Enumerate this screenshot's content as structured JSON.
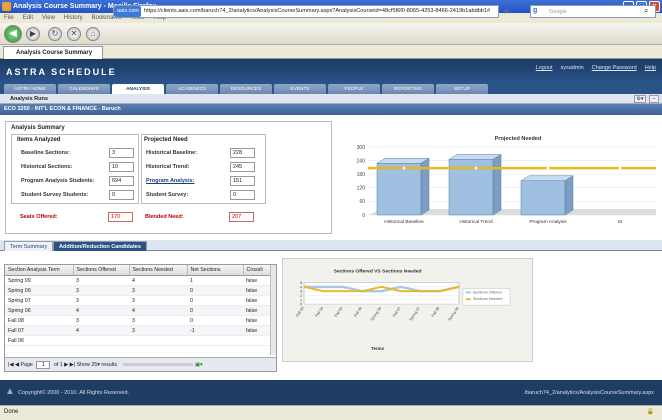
{
  "browser": {
    "title": "Analysis Course Summary - Mozilla Firefox",
    "menu": [
      "File",
      "Edit",
      "View",
      "History",
      "Bookmarks",
      "Tools",
      "Help"
    ],
    "url_badge": "aais.com",
    "url": "https://clients.aais.com/baruch74_2/analytics/AnalysisCourseSummary.aspx?AnalysisCourseid=48cf5f6f0-8065-4253-8466-2419b1abdbb1#",
    "search_placeholder": "Google",
    "tab": "Analysis Course Summary",
    "status": "Done"
  },
  "app": {
    "logo": "ASTRA SCHEDULE",
    "links": [
      "Logout",
      "sysadmin",
      "Change Password",
      "Help"
    ],
    "tabs": [
      "ASTRA HOME",
      "CALENDARS",
      "ANALYSIS",
      "ACADEMICS",
      "RESOURCES",
      "EVENTS",
      "PEOPLE",
      "REPORTING",
      "SETUP"
    ],
    "active_tab": "ANALYSIS",
    "subnav": "Analysis Runs",
    "section": "ECO 3250 - INT'L ECON & FINANCE - Baruch"
  },
  "summary": {
    "title": "Analysis Summary",
    "items_title": "Items Analyzed",
    "projected_title": "Projected Need",
    "items": [
      {
        "label": "Baseline Sections:",
        "value": "3"
      },
      {
        "label": "Historical Sections:",
        "value": "10"
      },
      {
        "label": "Program Analysis Students:",
        "value": "694"
      },
      {
        "label": "Student Survey Students:",
        "value": "0"
      }
    ],
    "projected": [
      {
        "label": "Historical Baseline:",
        "value": "228"
      },
      {
        "label": "Historical Trend:",
        "value": "245"
      },
      {
        "label": "Program Analysis:",
        "value": "151"
      },
      {
        "label": "Student Survey:",
        "value": "0"
      }
    ],
    "seats_label": "Seats Offered:",
    "seats_value": "170",
    "blended_label": "Blended Need:",
    "blended_value": "207"
  },
  "tabs2": [
    "Term Summary",
    "Addition/Reduction Candidates"
  ],
  "grid": {
    "headers": [
      "Section Analysis Term",
      "Sections Offered",
      "Sections Needed",
      "Net Sections",
      "Crossli"
    ],
    "rows": [
      [
        "Spring 09",
        "3",
        "4",
        "1",
        "false"
      ],
      [
        "Spring 09",
        "3",
        "3",
        "0",
        "false"
      ],
      [
        "Spring 07",
        "3",
        "3",
        "0",
        "false"
      ],
      [
        "Spring 06",
        "4",
        "4",
        "0",
        "false"
      ],
      [
        "Fall 08",
        "3",
        "3",
        "0",
        "false"
      ],
      [
        "Fall 07",
        "4",
        "3",
        "-1",
        "false"
      ],
      [
        "Fall 06",
        "",
        "",
        "",
        ""
      ]
    ],
    "pager": {
      "page_label": "Page",
      "page": "1",
      "of": "of 1",
      "show_label": "Show",
      "show_value": "25",
      "results": "results"
    }
  },
  "footer": {
    "copyright": "Copyright© 2000 - 2010. All Rights Reserved.",
    "path": "/baruch74_2/analytics/AnalysisCourseSummary.aspx"
  },
  "chart_data": [
    {
      "type": "bar",
      "title": "Projected Needed",
      "categories": [
        "Historical Baseline",
        "Historical Trend",
        "Program Analysis",
        "St"
      ],
      "values": [
        228,
        245,
        151,
        0
      ],
      "ylim": [
        0,
        300
      ],
      "yticks": [
        0,
        60,
        120,
        180,
        240,
        300
      ],
      "reference_line": 207,
      "colors": {
        "bar": "#9fc0e0",
        "line": "#e8b820"
      }
    },
    {
      "type": "line",
      "title": "Sections Offered VS Sections Needed",
      "xlabel": "Terms",
      "categories": [
        "Fall 03",
        "Fall 04",
        "Fall 05",
        "Fall 06",
        "Spring 06",
        "Fall 07",
        "Spring 07",
        "Fall 08",
        "Spring 09"
      ],
      "series": [
        {
          "name": "Sections Offered",
          "values": [
            4,
            4,
            4,
            3,
            3,
            4,
            3,
            3,
            4
          ],
          "color": "#a8c8e8"
        },
        {
          "name": "Sections Needed",
          "values": [
            4,
            3,
            3,
            3,
            4,
            3,
            3,
            3,
            4
          ],
          "color": "#e8b820"
        }
      ],
      "ylim": [
        0,
        5
      ],
      "yticks": [
        0,
        1,
        2,
        3,
        4,
        5
      ]
    }
  ]
}
